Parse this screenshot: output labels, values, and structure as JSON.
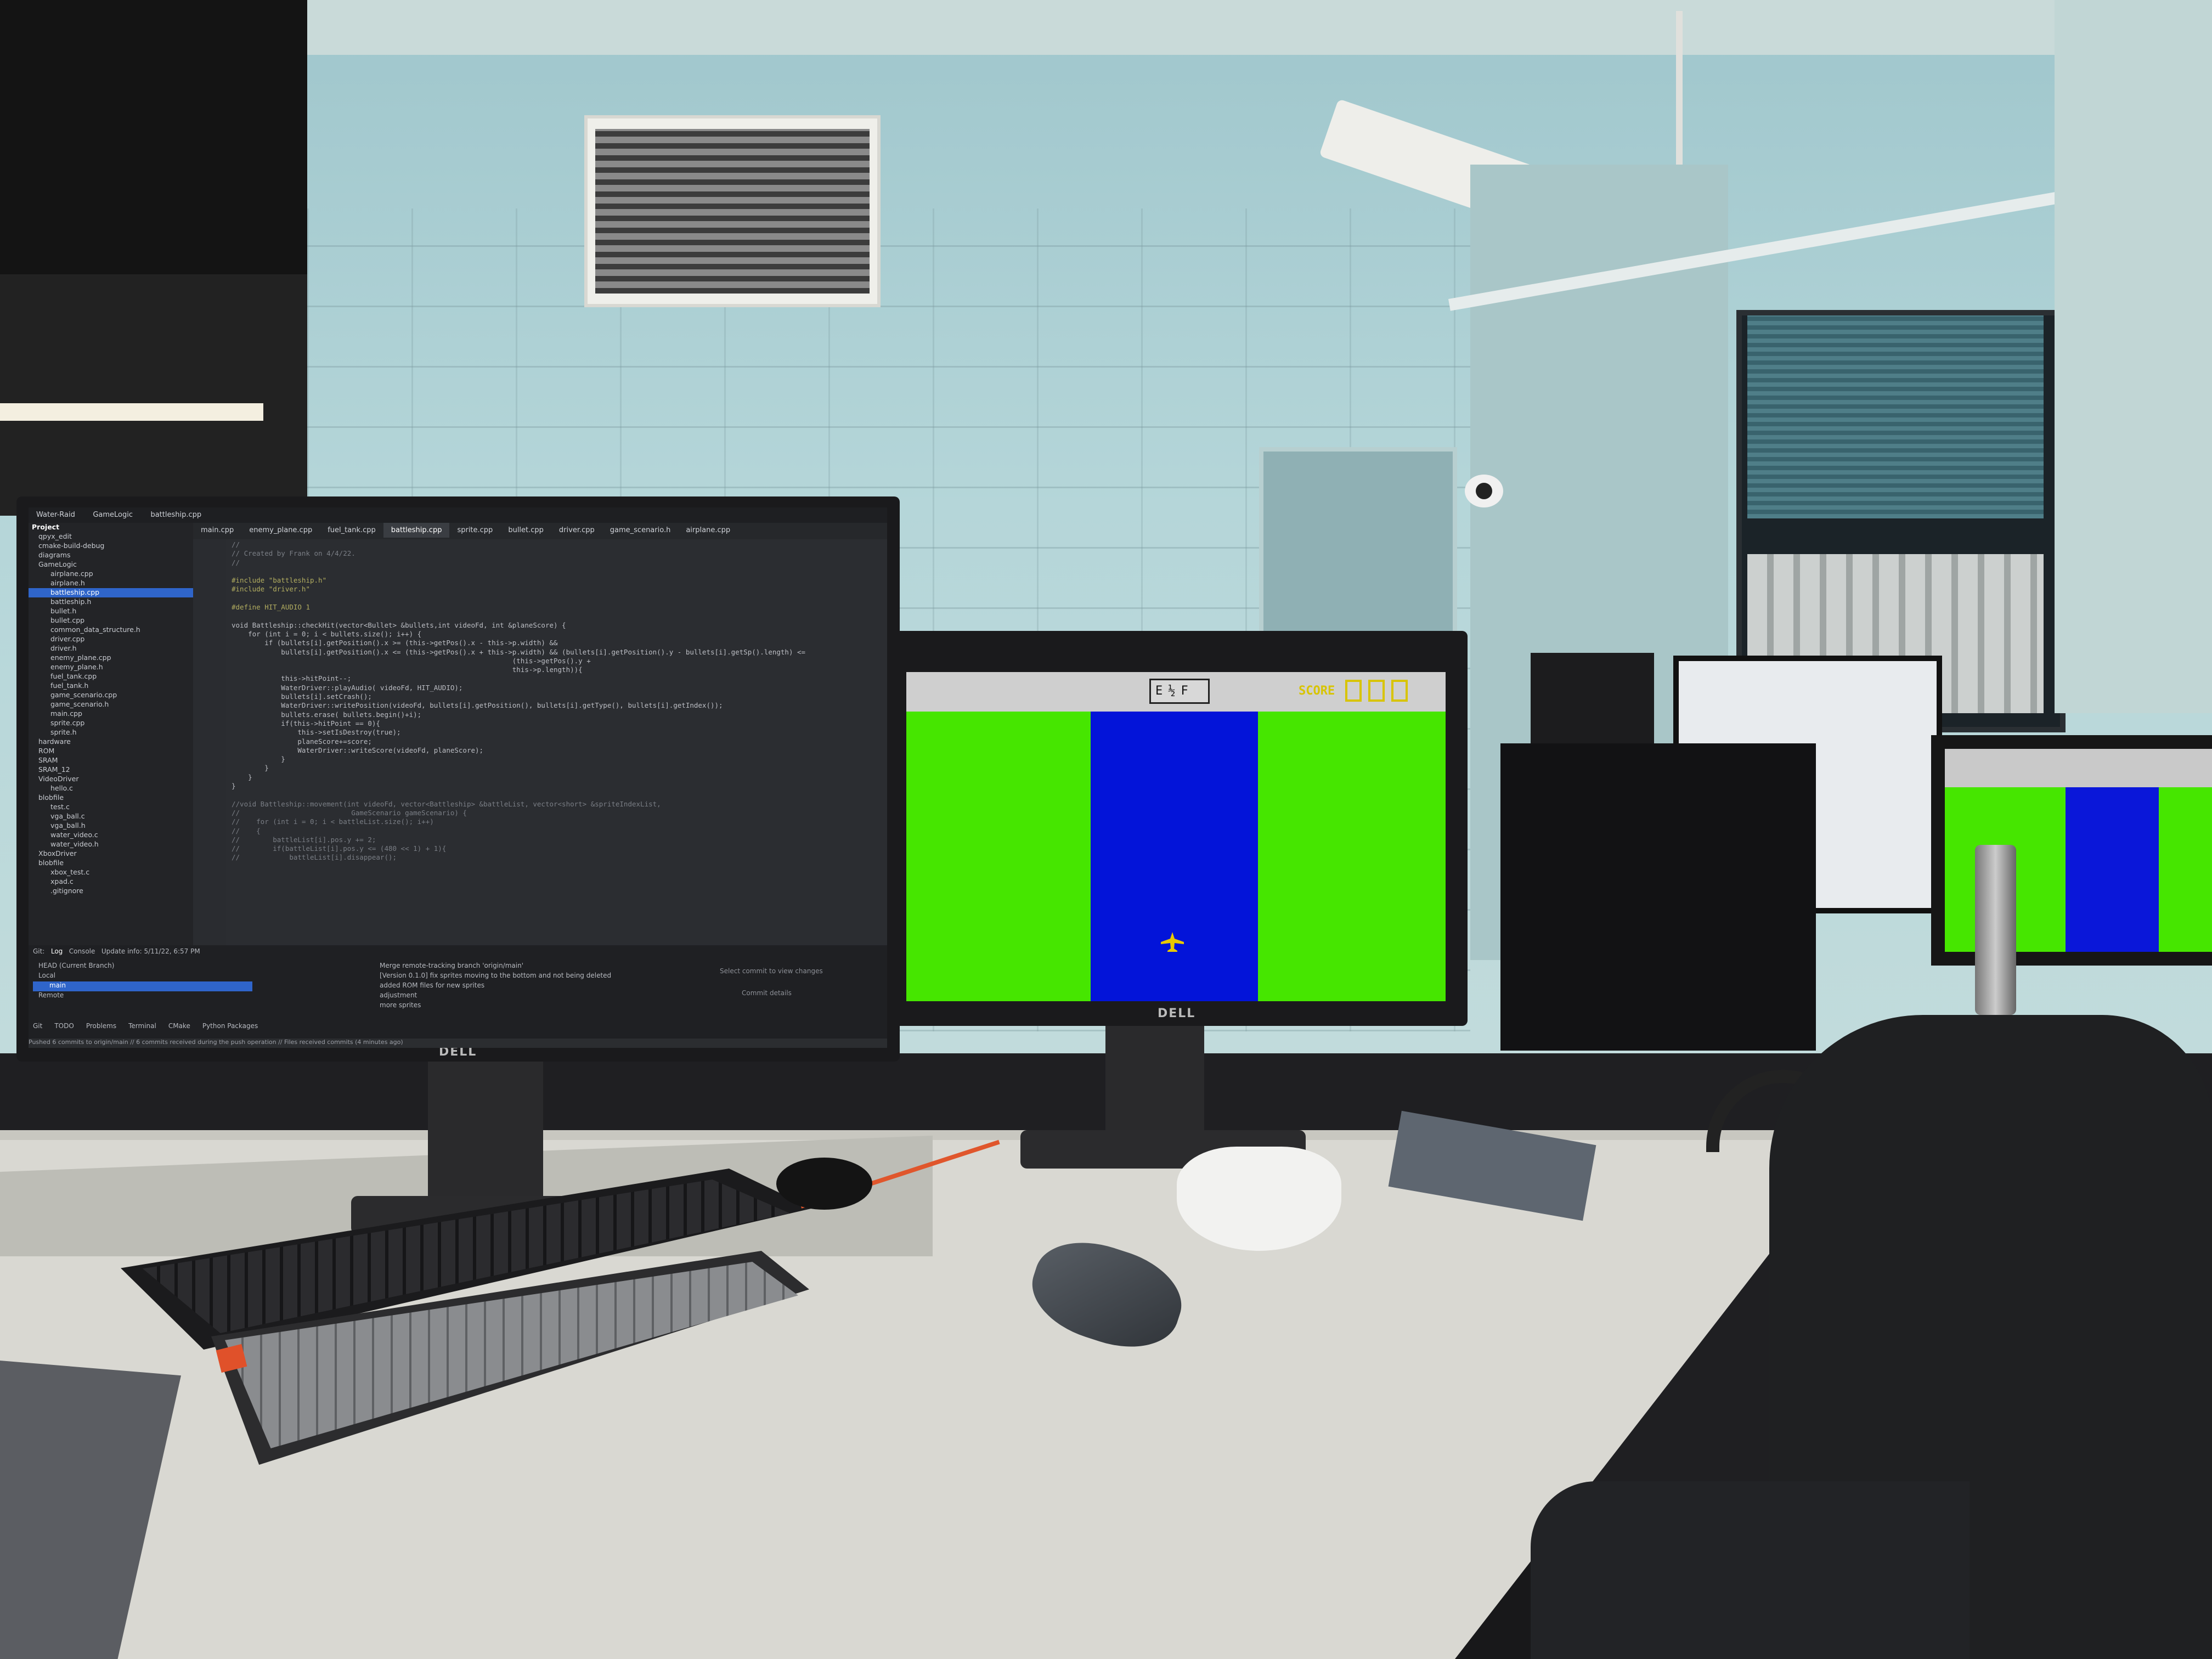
{
  "ide": {
    "window_title": "Water-Raid",
    "breadcrumbs": [
      "Water-Raid",
      "GameLogic",
      "battleship.cpp"
    ],
    "editor_tabs": [
      "main.cpp",
      "enemy_plane.cpp",
      "fuel_tank.cpp",
      "battleship.cpp",
      "sprite.cpp",
      "bullet.cpp",
      "driver.cpp",
      "game_scenario.h",
      "airplane.cpp"
    ],
    "project_label": "Project",
    "tree": [
      "qpyx_edit",
      "cmake-build-debug",
      "diagrams",
      "GameLogic",
      "airplane.cpp",
      "airplane.h",
      "battleship.cpp",
      "battleship.h",
      "bullet.h",
      "bullet.cpp",
      "common_data_structure.h",
      "driver.cpp",
      "driver.h",
      "enemy_plane.cpp",
      "enemy_plane.h",
      "fuel_tank.cpp",
      "fuel_tank.h",
      "game_scenario.cpp",
      "game_scenario.h",
      "main.cpp",
      "sprite.cpp",
      "sprite.h",
      "hardware",
      "ROM",
      "SRAM",
      "SRAM_12",
      "VideoDriver",
      "hello.c",
      "blobfile",
      "test.c",
      "vga_ball.c",
      "vga_ball.h",
      "water_video.c",
      "water_video.h",
      "XboxDriver",
      "blobfile",
      "xbox_test.c",
      "xpad.c",
      ".gitignore"
    ],
    "selected_tree_item": "battleship.cpp",
    "code_lines": [
      "//",
      "// Created by Frank on 4/4/22.",
      "//",
      "",
      "#include \"battleship.h\"",
      "#include \"driver.h\"",
      "",
      "#define HIT_AUDIO 1",
      "",
      "void Battleship::checkHit(vector<Bullet> &bullets,int videoFd, int &planeScore) {",
      "    for (int i = 0; i < bullets.size(); i++) {",
      "        if (bullets[i].getPosition().x >= (this->getPos().x - this->p.width) &&",
      "            bullets[i].getPosition().x <= (this->getPos().x + this->p.width) && (bullets[i].getPosition().y - bullets[i].getSp().length) <=",
      "                                                                    (this->getPos().y +",
      "                                                                    this->p.length)){",
      "            this->hitPoint--;",
      "            WaterDriver::playAudio( videoFd, HIT_AUDIO);",
      "            bullets[i].setCrash();",
      "            WaterDriver::writePosition(videoFd, bullets[i].getPosition(), bullets[i].getType(), bullets[i].getIndex());",
      "            bullets.erase( bullets.begin()+i);",
      "            if(this->hitPoint == 0){",
      "                this->setIsDestroy(true);",
      "                planeScore+=score;",
      "                WaterDriver::writeScore(videoFd, planeScore);",
      "            }",
      "        }",
      "    }",
      "}",
      "",
      "//void Battleship::movement(int videoFd, vector<Battleship> &battleList, vector<short> &spriteIndexList,",
      "//                           GameScenario gameScenario) {",
      "//    for (int i = 0; i < battleList.size(); i++)",
      "//    {",
      "//        battleList[i].pos.y += 2;",
      "//        if(battleList[i].pos.y <= (480 << 1) + 1){",
      "//            battleList[i].disappear();"
    ],
    "breadcrumb_bottom": "Battleship::checkHit",
    "bottom_tabs": [
      "Git:",
      "Log",
      "Console"
    ],
    "update_info": "Update info: 5/11/22, 6:57 PM",
    "branches": [
      "HEAD (Current Branch)",
      "Local",
      "main",
      "Remote"
    ],
    "commits": [
      "Merge remote-tracking branch 'origin/main'",
      "[Version 0.1.0] fix sprites moving to the bottom and not being deleted",
      "added ROM files for new sprites",
      "adjustment",
      "more sprites"
    ],
    "commit_hint": "Select commit to view changes",
    "commit_details": "Commit details",
    "tool_windows": [
      "Git",
      "TODO",
      "Problems",
      "Terminal",
      "CMake",
      "Python Packages"
    ],
    "status_text": "Pushed 6 commits to origin/main // 6 commits received during the push operation // Files received commits (4 minutes ago)"
  },
  "game": {
    "fuel_gauge_text": "E½F",
    "score_label": "SCORE",
    "score_digits": [
      "0",
      "0",
      "0"
    ],
    "colors": {
      "land": "#46e600",
      "river": "#0314d9",
      "hud": "#cfcfcf",
      "score": "#d8c400",
      "plane": "#e8c800"
    },
    "player": "plane-icon"
  },
  "monitor_brand": "DELL"
}
